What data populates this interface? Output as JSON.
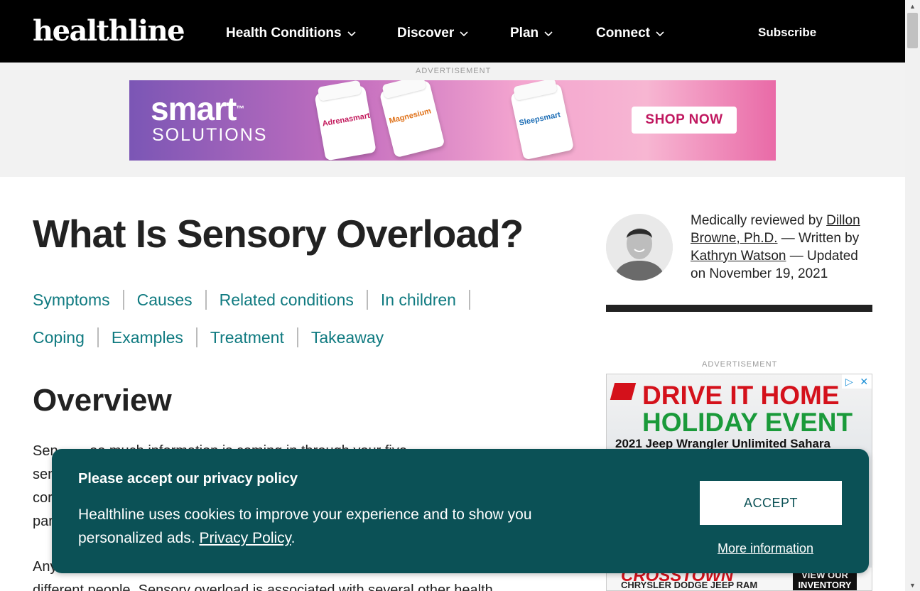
{
  "header": {
    "logo": "healthline",
    "nav": [
      {
        "label": "Health Conditions"
      },
      {
        "label": "Discover"
      },
      {
        "label": "Plan"
      },
      {
        "label": "Connect"
      }
    ],
    "subscribe": "Subscribe"
  },
  "top_ad": {
    "label": "ADVERTISEMENT",
    "brand": "smart",
    "brand_sub": "SOLUTIONS",
    "products": [
      "Adrenasmart",
      "Magnesium",
      "Sleepsmart"
    ],
    "cta": "SHOP NOW"
  },
  "article": {
    "title": "What Is Sensory Overload?",
    "toc_row1": [
      "Symptoms",
      "Causes",
      "Related conditions",
      "In children"
    ],
    "toc_row2": [
      "Coping",
      "Examples",
      "Treatment",
      "Takeaway"
    ],
    "section_heading": "Overview",
    "paragraph1_line1": "Sen",
    "paragraph1_line2": "sen",
    "paragraph1_line3": "cor",
    "paragraph1_line4": "par",
    "paragraph1_line1_tail": "oo much information is coming in through your five",
    "paragraph2_line1": "Any",
    "paragraph2_line2": "different people. Sensory overload is associated with several other health"
  },
  "byline": {
    "prefix": "Medically reviewed by ",
    "reviewer": "Dillon Browne, Ph.D.",
    "mid": " — Written by ",
    "author": "Kathryn Watson",
    "suffix": " — Updated on November 19, 2021"
  },
  "side_ad": {
    "label": "ADVERTISEMENT",
    "line1": "DRIVE IT HOME",
    "line2": "HOLIDAY EVENT",
    "line3": "2021 Jeep Wrangler Unlimited Sahara",
    "dealer": "CROSSTOWN",
    "dealer_sub": "CHRYSLER DODGE JEEP RAM",
    "inventory": "VIEW OUR INVENTORY"
  },
  "cookie": {
    "title": "Please accept our privacy policy",
    "message": "Healthline uses cookies to improve your experience and to show you personalized ads.",
    "policy_link": "Privacy Policy",
    "policy_after": ".",
    "accept": "ACCEPT",
    "more": "More information"
  },
  "colors": {
    "header_bg": "#000000",
    "link_teal": "#0f7a80",
    "cookie_bg": "#0b5156"
  }
}
